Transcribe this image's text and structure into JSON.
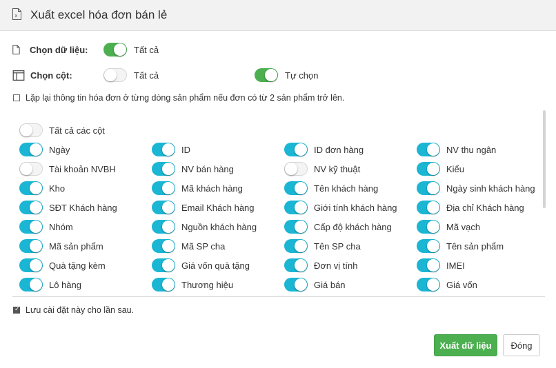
{
  "dialog": {
    "title": "Xuất excel hóa đơn bán lẻ",
    "icon": "excel-file-icon"
  },
  "select_data": {
    "label": "Chọn dữ liệu:",
    "icon": "document-icon",
    "toggle_on": true,
    "option_label": "Tất cả"
  },
  "select_columns": {
    "label": "Chọn cột:",
    "icon": "columns-icon",
    "all_on": false,
    "all_label": "Tất cả",
    "custom_on": true,
    "custom_label": "Tự chọn"
  },
  "repeat_option": {
    "checked": false,
    "label": "Lặp lại thông tin hóa đơn ở từng dòng sản phẩm nếu đơn có từ 2 sản phẩm trở lên."
  },
  "all_columns": {
    "label": "Tất cả các cột",
    "on": false
  },
  "columns": [
    [
      {
        "label": "Ngày",
        "on": true
      },
      {
        "label": "ID",
        "on": true
      },
      {
        "label": "ID đơn hàng",
        "on": true
      },
      {
        "label": "NV thu ngân",
        "on": true
      }
    ],
    [
      {
        "label": "Tài khoản NVBH",
        "on": false
      },
      {
        "label": "NV bán hàng",
        "on": true
      },
      {
        "label": "NV kỹ thuật",
        "on": false
      },
      {
        "label": "Kiểu",
        "on": true
      }
    ],
    [
      {
        "label": "Kho",
        "on": true
      },
      {
        "label": "Mã khách hàng",
        "on": true
      },
      {
        "label": "Tên khách hàng",
        "on": true
      },
      {
        "label": "Ngày sinh khách hàng",
        "on": true
      }
    ],
    [
      {
        "label": "SĐT Khách hàng",
        "on": true
      },
      {
        "label": "Email Khách hàng",
        "on": true
      },
      {
        "label": "Giới tính khách hàng",
        "on": true
      },
      {
        "label": "Địa chỉ Khách hàng",
        "on": true
      }
    ],
    [
      {
        "label": "Nhóm",
        "on": true
      },
      {
        "label": "Nguồn khách hàng",
        "on": true
      },
      {
        "label": "Cấp độ khách hàng",
        "on": true
      },
      {
        "label": "Mã vạch",
        "on": true
      }
    ],
    [
      {
        "label": "Mã sản phẩm",
        "on": true
      },
      {
        "label": "Mã SP cha",
        "on": true
      },
      {
        "label": "Tên SP cha",
        "on": true
      },
      {
        "label": "Tên sản phẩm",
        "on": true
      }
    ],
    [
      {
        "label": "Quà tặng kèm",
        "on": true
      },
      {
        "label": "Giá vốn quà tặng",
        "on": true
      },
      {
        "label": "Đơn vị tính",
        "on": true
      },
      {
        "label": "IMEI",
        "on": true
      }
    ],
    [
      {
        "label": "Lô hàng",
        "on": true
      },
      {
        "label": "Thương hiệu",
        "on": true
      },
      {
        "label": "Giá bán",
        "on": true
      },
      {
        "label": "Giá vốn",
        "on": true
      }
    ]
  ],
  "save_settings": {
    "checked": true,
    "label": "Lưu cài đặt này cho lần sau."
  },
  "buttons": {
    "export": "Xuất dữ liệu",
    "close": "Đóng"
  },
  "colors": {
    "green": "#4caf50",
    "teal": "#1ab6d4"
  }
}
